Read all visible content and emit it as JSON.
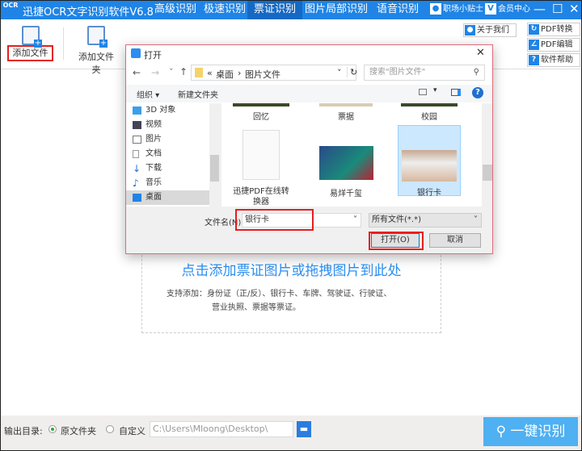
{
  "app": {
    "logo": "OCR",
    "title": "迅捷OCR文字识别软件V6.8",
    "nav": [
      "高级识别",
      "极速识别",
      "票证识别",
      "图片局部识别",
      "语音识别"
    ],
    "active_nav": 2,
    "tips": "职场小贴士",
    "member": "会员中心",
    "member_icon": "V",
    "minimize": "—",
    "maximize": "☐",
    "close": "✕",
    "accent": "#1f84e6"
  },
  "toolbar": {
    "add_file": "添加文件",
    "add_folder": "添加文件夹",
    "about": "关于我们",
    "pdf_convert": "PDF转换",
    "pdf_edit": "PDF编辑",
    "help": "软件帮助",
    "help_icon": "?"
  },
  "drop": {
    "title": "点击添加票证图片或拖拽图片到此处",
    "desc1": "支持添加：身份证（正/反）、银行卡、车牌、驾驶证、行驶证、",
    "desc2": "营业执照、票据等票证。"
  },
  "bottom": {
    "output_label": "输出目录:",
    "opt_original": "原文件夹",
    "opt_custom": "自定义",
    "path": "C:\\Users\\Mloong\\Desktop\\",
    "selected": "原文件夹",
    "recognize": "一键识别"
  },
  "dialog": {
    "title": "打开",
    "close": "✕",
    "back": "←",
    "forward": "→",
    "up": "↑",
    "recent": "˅",
    "breadcrumb_prefix": "«",
    "breadcrumb": [
      "桌面",
      "图片文件"
    ],
    "sep": "›",
    "refresh": "↻",
    "search_placeholder": "搜索\"图片文件\"",
    "organize": "组织 ▾",
    "new_folder": "新建文件夹",
    "help_icon": "?",
    "nav": [
      {
        "label": "3D 对象",
        "icon": "cube-icon"
      },
      {
        "label": "视频",
        "icon": "video-icon"
      },
      {
        "label": "图片",
        "icon": "picture-icon"
      },
      {
        "label": "文档",
        "icon": "document-icon"
      },
      {
        "label": "下载",
        "icon": "download-icon"
      },
      {
        "label": "音乐",
        "icon": "music-icon"
      },
      {
        "label": "桌面",
        "icon": "desktop-icon"
      }
    ],
    "selected_nav": "桌面",
    "files_row1": [
      "回忆",
      "票据",
      "校园"
    ],
    "files_row2": [
      {
        "label": "迅捷PDF在线转换器",
        "kind": "document"
      },
      {
        "label": "易烊千玺",
        "kind": "image"
      },
      {
        "label": "银行卡",
        "kind": "image",
        "selected": true
      }
    ],
    "filename_label": "文件名(N):",
    "filename": "银行卡",
    "filetype": "所有文件(*.*)",
    "open": "打开(O)",
    "cancel": "取消"
  }
}
